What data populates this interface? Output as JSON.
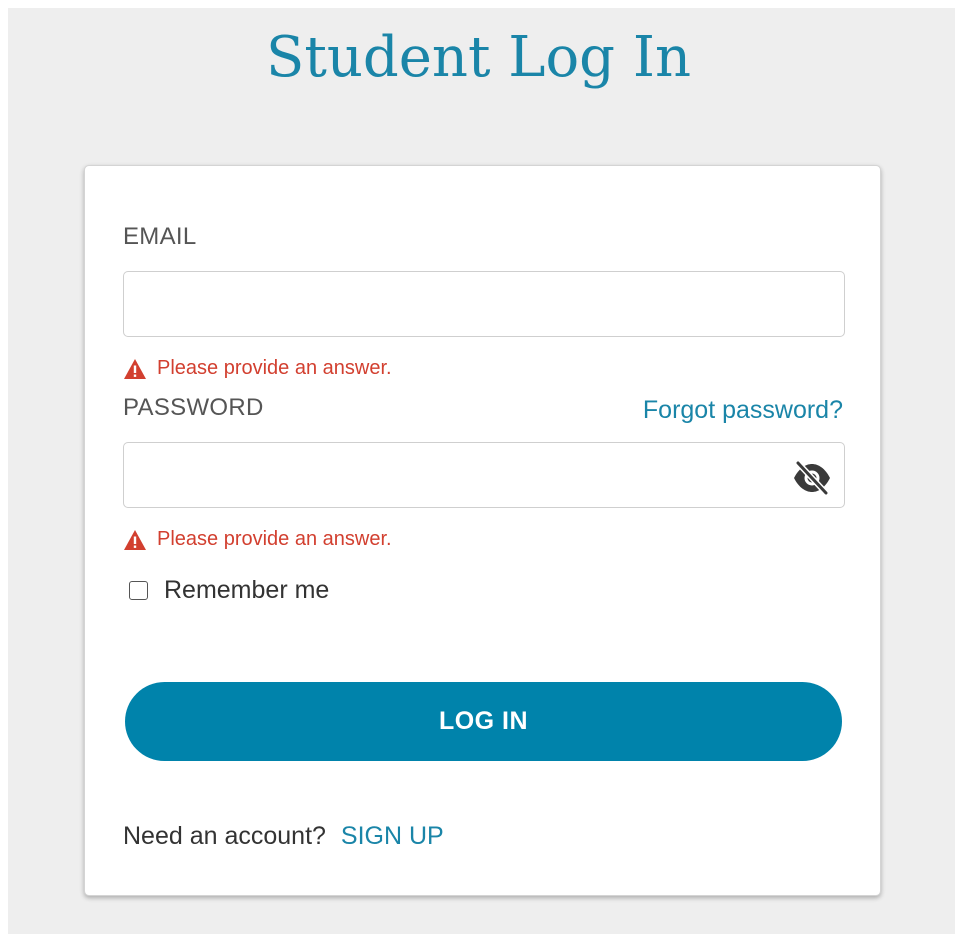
{
  "page": {
    "title": "Student Log In"
  },
  "form": {
    "email": {
      "label": "EMAIL",
      "value": "",
      "placeholder": "",
      "error": "Please provide an answer."
    },
    "password": {
      "label": "PASSWORD",
      "value": "",
      "placeholder": "",
      "error": "Please provide an answer.",
      "forgot_link": "Forgot password?",
      "toggle_icon": "eye-slash-icon"
    },
    "remember": {
      "label": "Remember me",
      "checked": false
    },
    "submit_label": "LOG IN",
    "signup": {
      "prompt": "Need an account?",
      "link": "SIGN UP"
    }
  },
  "colors": {
    "accent": "#0083ab",
    "link": "#1a85a8",
    "error": "#d23f2f",
    "background": "#eeeeee"
  }
}
